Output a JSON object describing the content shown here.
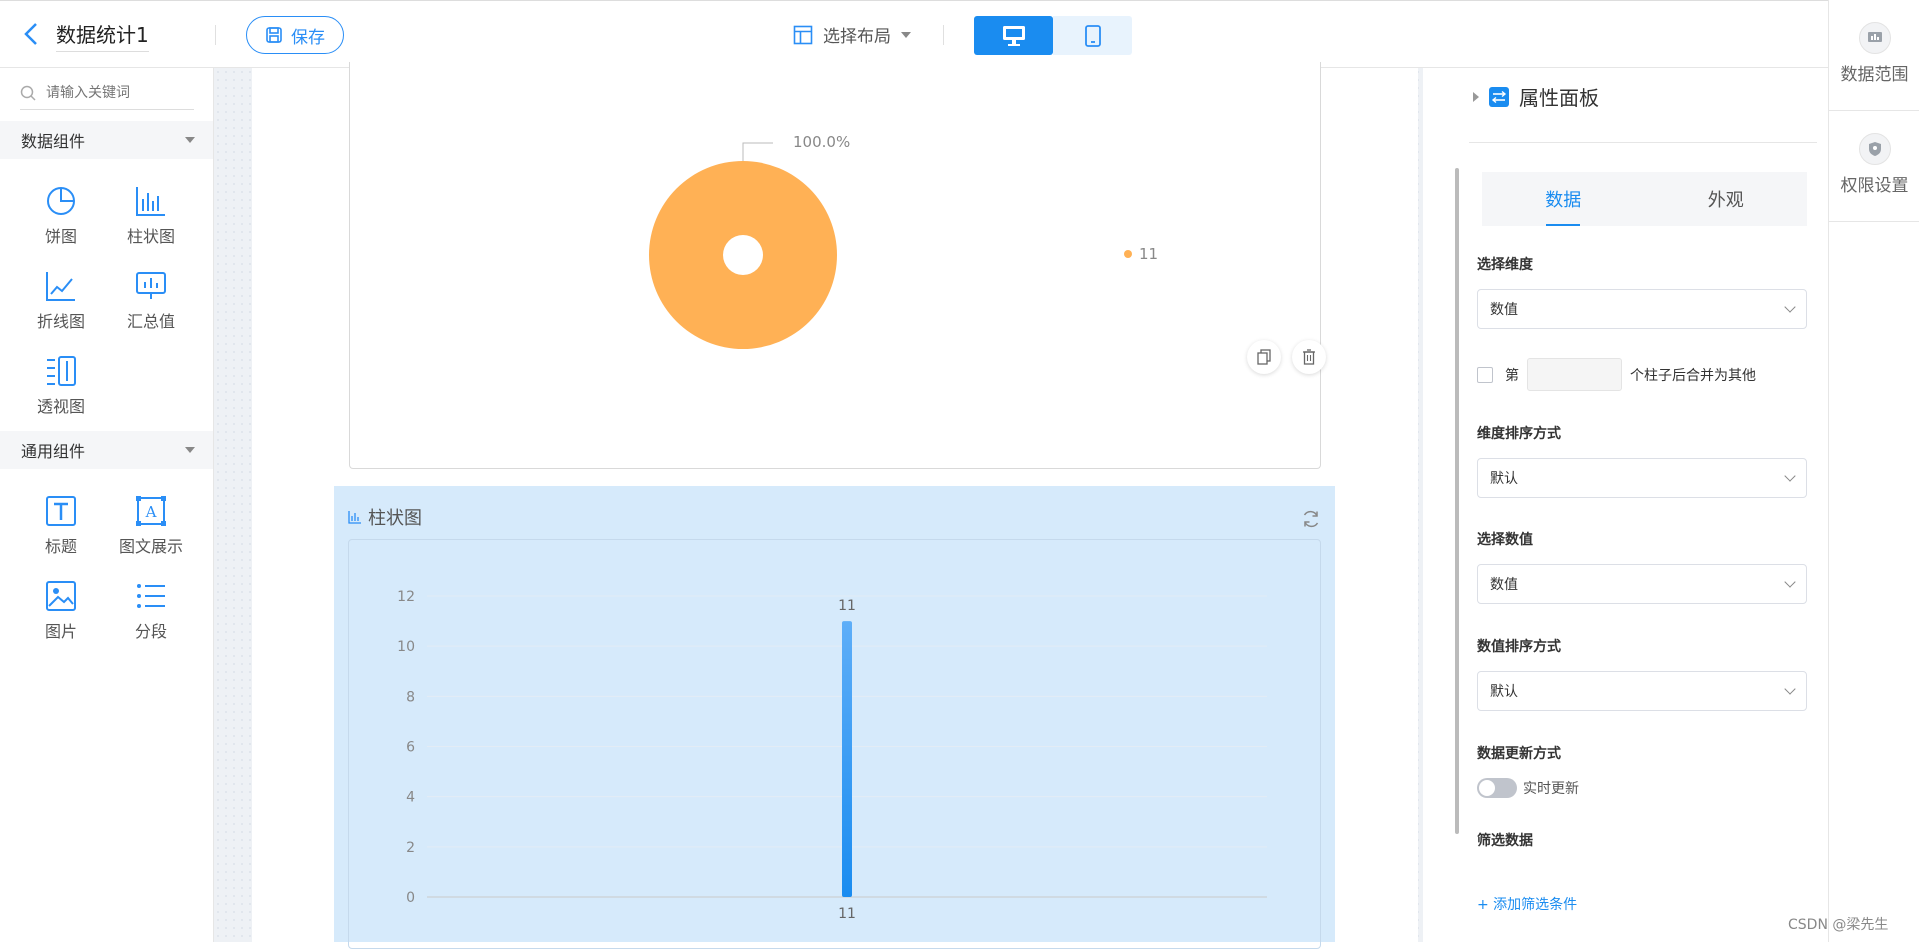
{
  "topbar": {
    "title": "数据统计1",
    "save_label": "保存",
    "layout_label": "选择布局"
  },
  "right_rail": [
    {
      "label": "数据范围",
      "icon": "data-range-icon"
    },
    {
      "label": "权限设置",
      "icon": "shield-icon"
    }
  ],
  "left_panel": {
    "search_placeholder": "请输入关键词",
    "data_group_title": "数据组件",
    "data_components": [
      "饼图",
      "柱状图",
      "折线图",
      "汇总值",
      "透视图"
    ],
    "common_group_title": "通用组件",
    "common_components": [
      "标题",
      "图文展示",
      "图片",
      "分段"
    ]
  },
  "pie_card": {
    "percent_label": "100.0%",
    "legend_label": "11",
    "slice_color": "#ffb155"
  },
  "bar_card": {
    "title": "柱状图"
  },
  "chart_data": [
    {
      "type": "pie",
      "labels": [
        "11"
      ],
      "values": [
        100.0
      ],
      "data_labels": [
        "100.0%"
      ],
      "colors": [
        "#ffb155"
      ],
      "legend": "right"
    },
    {
      "type": "bar",
      "title": "柱状图",
      "categories": [
        "11"
      ],
      "values": [
        11
      ],
      "data_labels": [
        "11"
      ],
      "ylim": [
        0,
        12
      ],
      "yticks": [
        0,
        2,
        4,
        6,
        8,
        10,
        12
      ],
      "grid": true,
      "color": "#1a8cf0"
    }
  ],
  "property_panel": {
    "title": "属性面板",
    "tabs": [
      "数据",
      "外观"
    ],
    "dimension_label": "选择维度",
    "dimension_value": "数值",
    "merge_prefix": "第",
    "merge_suffix": "个柱子后合并为其他",
    "dim_sort_label": "维度排序方式",
    "dim_sort_value": "默认",
    "value_label": "选择数值",
    "value_value": "数值",
    "value_sort_label": "数值排序方式",
    "value_sort_value": "默认",
    "update_label": "数据更新方式",
    "realtime_label": "实时更新",
    "filter_label": "筛选数据",
    "add_filter": "+ 添加筛选条件"
  },
  "watermark": "CSDN @梁先生"
}
